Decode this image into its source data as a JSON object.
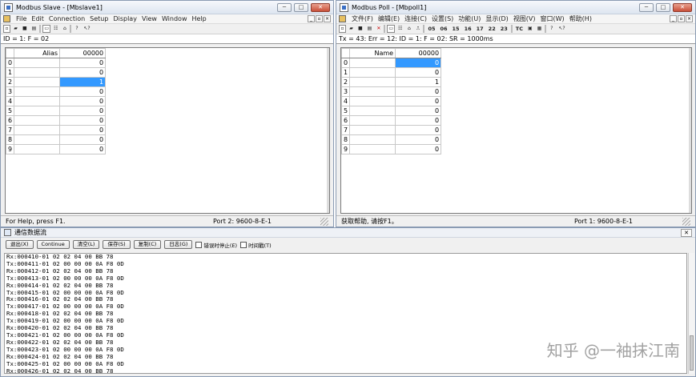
{
  "slave": {
    "title": "Modbus Slave - [Mbslave1]",
    "menu": [
      "File",
      "Edit",
      "Connection",
      "Setup",
      "Display",
      "View",
      "Window",
      "Help"
    ],
    "status_line": "ID = 1: F = 02",
    "grid": {
      "alias_header": "Alias",
      "col_header": "00000",
      "rows": [
        {
          "i": "0",
          "v": "0"
        },
        {
          "i": "1",
          "v": "0"
        },
        {
          "i": "2",
          "v": "1"
        },
        {
          "i": "3",
          "v": "0"
        },
        {
          "i": "4",
          "v": "0"
        },
        {
          "i": "5",
          "v": "0"
        },
        {
          "i": "6",
          "v": "0"
        },
        {
          "i": "7",
          "v": "0"
        },
        {
          "i": "8",
          "v": "0"
        },
        {
          "i": "9",
          "v": "0"
        }
      ],
      "selected_row": 2
    },
    "statusbar": {
      "left": "For Help, press F1.",
      "right": "Port 2: 9600-8-E-1"
    }
  },
  "poll": {
    "title": "Modbus Poll - [Mbpoll1]",
    "menu": [
      "文件(F)",
      "编辑(E)",
      "连接(C)",
      "设置(S)",
      "功能(U)",
      "显示(D)",
      "视图(V)",
      "窗口(W)",
      "帮助(H)"
    ],
    "function_buttons": [
      "05",
      "06",
      "15",
      "16",
      "17",
      "22",
      "23",
      "TC"
    ],
    "status_line": "Tx = 43: Err = 12: ID = 1: F = 02: SR = 1000ms",
    "grid": {
      "alias_header": "Name",
      "col_header": "00000",
      "rows": [
        {
          "i": "0",
          "v": "0"
        },
        {
          "i": "1",
          "v": "0"
        },
        {
          "i": "2",
          "v": "1"
        },
        {
          "i": "3",
          "v": "0"
        },
        {
          "i": "4",
          "v": "0"
        },
        {
          "i": "5",
          "v": "0"
        },
        {
          "i": "6",
          "v": "0"
        },
        {
          "i": "7",
          "v": "0"
        },
        {
          "i": "8",
          "v": "0"
        },
        {
          "i": "9",
          "v": "0"
        }
      ],
      "selected_row": 0
    },
    "statusbar": {
      "left": "获取帮助, 请按F1。",
      "right": "Port 1: 9600-8-E-1"
    }
  },
  "comm": {
    "title": "通信数据流",
    "buttons": [
      "退出(X)",
      "Continue",
      "清空(L)",
      "保存(S)",
      "复制(C)",
      "日志(G)"
    ],
    "checkboxes": [
      "错误时停止(E)",
      "时间戳(T)"
    ],
    "lines": [
      "Rx:000410-01 02 02 04 00 BB 78",
      "Tx:000411-01 02 00 00 00 0A F8 0D",
      "Rx:000412-01 02 02 04 00 BB 78",
      "Tx:000413-01 02 00 00 00 0A F8 0D",
      "Rx:000414-01 02 02 04 00 BB 78",
      "Tx:000415-01 02 00 00 00 0A F8 0D",
      "Rx:000416-01 02 02 04 00 BB 78",
      "Tx:000417-01 02 00 00 00 0A F8 0D",
      "Rx:000418-01 02 02 04 00 BB 78",
      "Tx:000419-01 02 00 00 00 0A F8 0D",
      "Rx:000420-01 02 02 04 00 BB 78",
      "Tx:000421-01 02 00 00 00 0A F8 0D",
      "Rx:000422-01 02 02 04 00 BB 78",
      "Tx:000423-01 02 00 00 00 0A F8 0D",
      "Rx:000424-01 02 02 04 00 BB 78",
      "Tx:000425-01 02 00 00 00 0A F8 0D",
      "Rx:000426-01 02 02 04 00 BB 78"
    ]
  },
  "watermark": "知乎 @一袖抹江南"
}
